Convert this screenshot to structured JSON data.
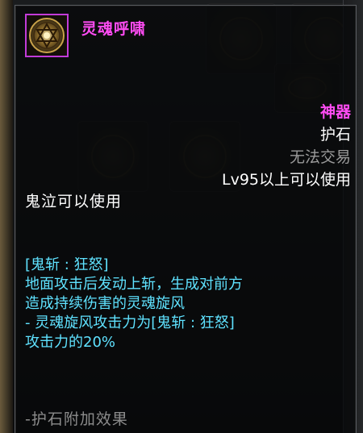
{
  "item": {
    "name": "灵魂呼啸",
    "rarity": "神器",
    "type": "护石",
    "trade_status": "无法交易",
    "level_requirement": "Lv95以上可以使用",
    "class_requirement": "鬼泣可以使用"
  },
  "description": {
    "lines": [
      "[鬼斩 : 狂怒]",
      "地面攻击后发动上斩，生成对前方",
      "造成持续伤害的灵魂旋风",
      "- 灵魂旋风攻击力为[鬼斩 : 狂怒]",
      "攻击力的20%"
    ]
  },
  "bonus_section": {
    "title": "-护石附加效果"
  },
  "colors": {
    "name": "#ff4cf3",
    "rarity": "#ff4cf3",
    "description": "#5fe2ff",
    "trade_status": "#9a9a9a",
    "bonus_title": "#8c8c8c",
    "icon_border": "#c23bd8"
  },
  "icons": {
    "item_icon": "hexagram-seal-icon"
  }
}
